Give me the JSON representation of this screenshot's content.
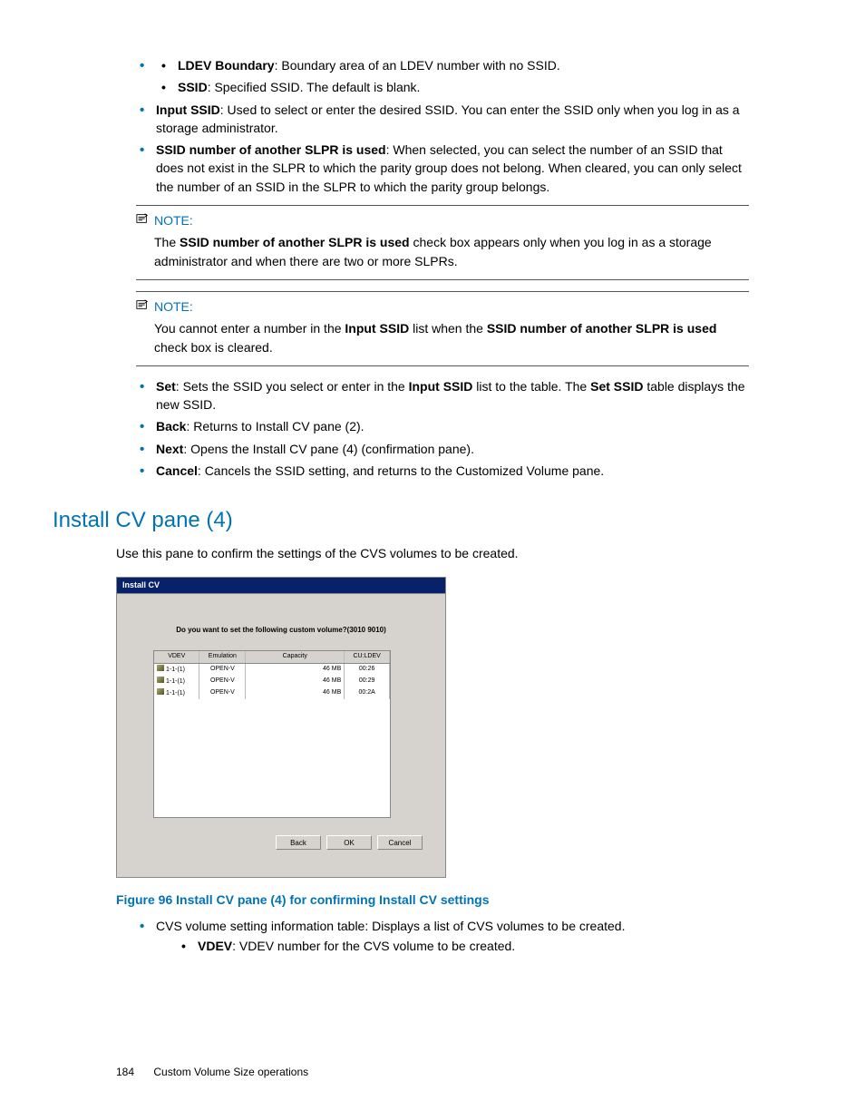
{
  "top_sub": {
    "ldev_boundary_label": "LDEV Boundary",
    "ldev_boundary_text": ": Boundary area of an LDEV number with no SSID.",
    "ssid_label": "SSID",
    "ssid_text": ": Specified SSID. The default is blank."
  },
  "bullets": {
    "input_ssid_label": "Input SSID",
    "input_ssid_text": ": Used to select or enter the desired SSID. You can enter the SSID only when you log in as a storage administrator.",
    "another_slpr_label": "SSID number of another SLPR is used",
    "another_slpr_text": ": When selected, you can select the number of an SSID that does not exist in the SLPR to which the parity group does not belong. When cleared, you can only select the number of an SSID in the SLPR to which the parity group belongs."
  },
  "note1": {
    "label": "NOTE:",
    "pre": "The ",
    "bold": "SSID number of another SLPR is used",
    "post": " check box appears only when you log in as a storage administrator and when there are two or more SLPRs."
  },
  "note2": {
    "label": "NOTE:",
    "pre": "You cannot enter a number in the ",
    "bold1": "Input SSID",
    "mid": " list when the ",
    "bold2": "SSID number of another SLPR is used",
    "post": " check box is cleared."
  },
  "bullets2": {
    "set_label": "Set",
    "set_mid1": ": Sets the SSID you select or enter in the ",
    "set_bold1": "Input SSID",
    "set_mid2": " list to the table. The ",
    "set_bold2": "Set SSID",
    "set_post": " table displays the new SSID.",
    "back_label": "Back",
    "back_text": ": Returns to Install CV pane (2).",
    "next_label": "Next",
    "next_text": ": Opens the Install CV pane (4) (confirmation pane).",
    "cancel_label": "Cancel",
    "cancel_text": ": Cancels the SSID setting, and returns to the Customized Volume pane."
  },
  "section_heading": "Install CV pane (4)",
  "section_intro": "Use this pane to confirm the settings of the CVS volumes to be created.",
  "screenshot": {
    "title": "Install CV",
    "question": "Do you want to set the following custom volume?(3010 9010)",
    "headers": [
      "VDEV",
      "Emulation",
      "Capacity",
      "CU:LDEV"
    ],
    "rows": [
      [
        "1-1-(1)",
        "OPEN-V",
        "46 MB",
        "00:26"
      ],
      [
        "1-1-(1)",
        "OPEN-V",
        "46 MB",
        "00:29"
      ],
      [
        "1-1-(1)",
        "OPEN-V",
        "46 MB",
        "00:2A"
      ]
    ],
    "buttons": {
      "back": "Back",
      "ok": "OK",
      "cancel": "Cancel"
    }
  },
  "figure_caption": "Figure 96 Install CV pane (4) for confirming Install CV settings",
  "post_fig": {
    "item1": "CVS volume setting information table: Displays a list of CVS volumes to be created.",
    "sub_label": "VDEV",
    "sub_text": ": VDEV number for the CVS volume to be created."
  },
  "footer": {
    "page": "184",
    "title": "Custom Volume Size operations"
  }
}
